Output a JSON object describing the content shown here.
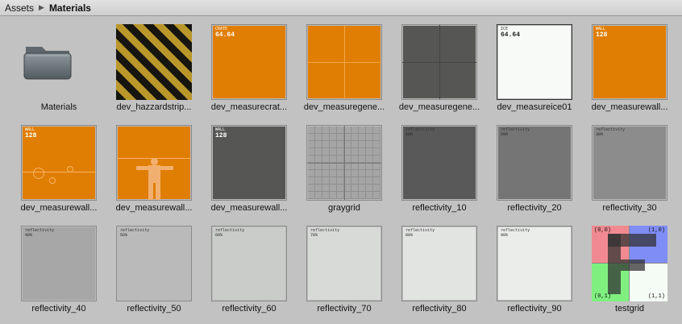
{
  "breadcrumb": {
    "root": "Assets",
    "current": "Materials"
  },
  "colors": {
    "orange": "#e07e04",
    "darkgray": "#565754",
    "panel_bg": "#c2c2c2"
  },
  "assets": [
    {
      "label": "Materials",
      "kind": "folder"
    },
    {
      "label": "dev_hazzardstrip...",
      "kind": "hazard"
    },
    {
      "label": "dev_measurecrat...",
      "kind": "orange",
      "tag": "CRATE",
      "value": "64.64"
    },
    {
      "label": "dev_measuregene...",
      "kind": "orange-cross"
    },
    {
      "label": "dev_measuregene...",
      "kind": "dark-cross"
    },
    {
      "label": "dev_measureice01",
      "kind": "white",
      "tag": "ICE",
      "value": "64.64"
    },
    {
      "label": "dev_measurewall...",
      "kind": "orange",
      "tag": "WALL",
      "value": "128"
    },
    {
      "label": "dev_measurewall...",
      "kind": "orange-wall",
      "tag": "WALL",
      "value": "128"
    },
    {
      "label": "dev_measurewall...",
      "kind": "orange-figure"
    },
    {
      "label": "dev_measurewall...",
      "kind": "dark",
      "tag": "WALL",
      "value": "128"
    },
    {
      "label": "graygrid",
      "kind": "graygrid"
    },
    {
      "label": "reflectivity_10",
      "kind": "refl",
      "tag": "reflectivity",
      "value": "10%",
      "color": "#595959"
    },
    {
      "label": "reflectivity_20",
      "kind": "refl",
      "tag": "reflectivity",
      "value": "20%",
      "color": "#757575"
    },
    {
      "label": "reflectivity_30",
      "kind": "refl",
      "tag": "reflectivity",
      "value": "30%",
      "color": "#8c8c8c"
    },
    {
      "label": "reflectivity_40",
      "kind": "refl",
      "tag": "reflectivity",
      "value": "40%",
      "color": "#a7a7a7"
    },
    {
      "label": "reflectivity_50",
      "kind": "refl",
      "tag": "reflectivity",
      "value": "50%",
      "color": "#b9bab9"
    },
    {
      "label": "reflectivity_60",
      "kind": "refl",
      "tag": "reflectivity",
      "value": "60%",
      "color": "#c9ccc9"
    },
    {
      "label": "reflectivity_70",
      "kind": "refl",
      "tag": "reflectivity",
      "value": "70%",
      "color": "#d8dad8"
    },
    {
      "label": "reflectivity_80",
      "kind": "refl",
      "tag": "reflectivity",
      "value": "80%",
      "color": "#e2e4e2"
    },
    {
      "label": "reflectivity_90",
      "kind": "refl",
      "tag": "reflectivity",
      "value": "90%",
      "color": "#ebedeb"
    },
    {
      "label": "testgrid",
      "kind": "testgrid",
      "corners": [
        "(0,0)",
        "(1,0)",
        "(0,1)",
        "(1,1)"
      ]
    }
  ]
}
